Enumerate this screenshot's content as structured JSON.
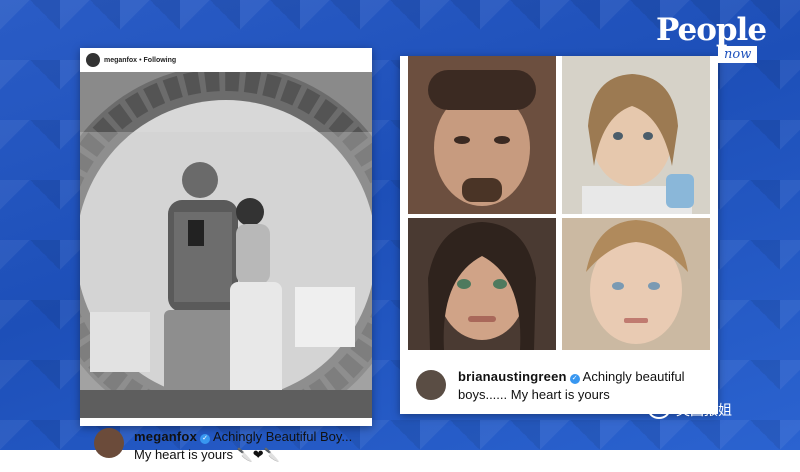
{
  "logo": {
    "brand": "People",
    "sub": "now"
  },
  "left_post": {
    "header_user": "meganfox",
    "header_separator": "•",
    "header_follow": "Following",
    "caption_user": "meganfox",
    "caption_text": "Achingly Beautiful Boy... My heart is yours 🔪❤🔪"
  },
  "right_post": {
    "caption_user": "brianaustingreen",
    "caption_text": "Achingly beautiful boys...... My heart is yours"
  },
  "watermark": {
    "text": "英国报姐"
  },
  "colors": {
    "background": "#2358c4",
    "verified": "#3897f0"
  }
}
